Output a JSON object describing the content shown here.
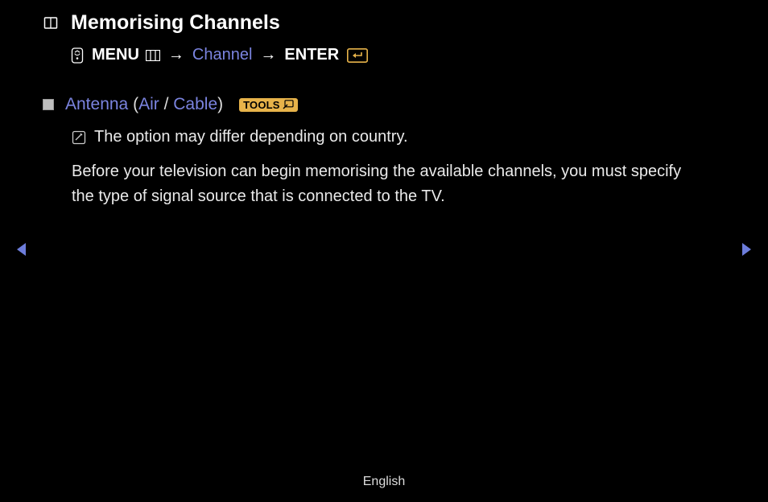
{
  "title": "Memorising Channels",
  "breadcrumb": {
    "menu": "MENU",
    "channel": "Channel",
    "enter": "ENTER",
    "arrow": "→"
  },
  "section": {
    "antenna": "Antenna",
    "paren_open": " (",
    "air": "Air",
    "slash": " / ",
    "cable": "Cable",
    "paren_close": ")",
    "tools_label": "TOOLS"
  },
  "note": "The option may differ depending on country.",
  "body": "Before your television can begin memorising the available channels, you must specify the type of signal source that is connected to the TV.",
  "footer": {
    "language": "English"
  }
}
